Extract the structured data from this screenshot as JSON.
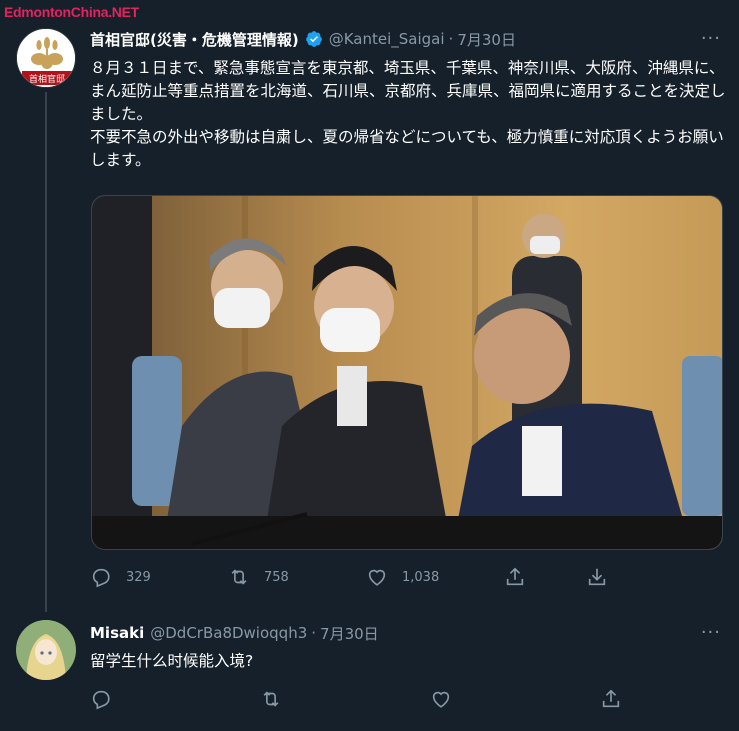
{
  "watermark": "EdmontonChina.NET",
  "tweet": {
    "author_name": "首相官邸(災害・危機管理情報)",
    "handle": "@Kantei_Saigai",
    "separator": "·",
    "date": "7月30日",
    "more": "···",
    "avatar_caption": "首相官邸",
    "text": "８月３１日まで、緊急事態宣言を東京都、埼玉県、千葉県、神奈川県、大阪府、沖縄県に、まん延防止等重点措置を北海道、石川県、京都府、兵庫県、福岡県に適用することを決定しました。\n不要不急の外出や移動は自粛し、夏の帰省などについても、極力慎重に対応頂くようお願いします。",
    "stats": {
      "replies": "329",
      "retweets": "758",
      "likes": "1,038"
    }
  },
  "reply": {
    "author_name": "Misaki",
    "handle": "@DdCrBa8Dwioqqh3",
    "separator": "·",
    "date": "7月30日",
    "more": "···",
    "text": "留学生什么时候能入境?"
  },
  "colors": {
    "background": "#15202b",
    "secondary_text": "#8899a6",
    "verified": "#1da1f2",
    "watermark": "#e0245e"
  },
  "icons": [
    "reply-icon",
    "retweet-icon",
    "like-icon",
    "share-icon",
    "download-icon",
    "verified-badge-icon",
    "more-icon"
  ]
}
